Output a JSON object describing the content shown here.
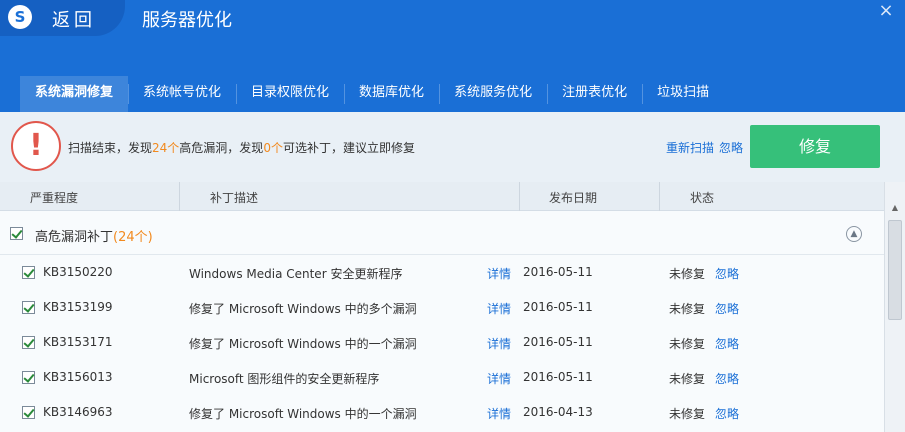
{
  "app": {
    "logo_letter": "S",
    "back_label": "返回",
    "title": "服务器优化",
    "close_glyph": "×"
  },
  "tabs": [
    {
      "label": "系统漏洞修复",
      "active": true
    },
    {
      "label": "系统帐号优化"
    },
    {
      "label": "目录权限优化"
    },
    {
      "label": "数据库优化"
    },
    {
      "label": "系统服务优化"
    },
    {
      "label": "注册表优化"
    },
    {
      "label": "垃圾扫描"
    }
  ],
  "scan_status": {
    "prefix": "扫描结束，发现",
    "high_risk_count": "24个",
    "middle": "高危漏洞，发现",
    "optional_count": "0个",
    "suffix": "可选补丁，建议立即修复",
    "rescan_label": "重新扫描",
    "ignore_label": "忽略",
    "repair_label": "修复",
    "alert_glyph": "!"
  },
  "columns": {
    "severity": "严重程度",
    "description": "补丁描述",
    "date": "发布日期",
    "status": "状态"
  },
  "group": {
    "label": "高危漏洞补丁",
    "count": "(24个)",
    "checked": true
  },
  "patches": [
    {
      "kb": "KB3150220",
      "desc": "Windows Media Center 安全更新程序",
      "detail": "详情",
      "date": "2016-05-11",
      "status": "未修复",
      "ignore": "忽略"
    },
    {
      "kb": "KB3153199",
      "desc": "修复了 Microsoft Windows 中的多个漏洞",
      "detail": "详情",
      "date": "2016-05-11",
      "status": "未修复",
      "ignore": "忽略"
    },
    {
      "kb": "KB3153171",
      "desc": "修复了 Microsoft Windows 中的一个漏洞",
      "detail": "详情",
      "date": "2016-05-11",
      "status": "未修复",
      "ignore": "忽略"
    },
    {
      "kb": "KB3156013",
      "desc": "Microsoft 图形组件的安全更新程序",
      "detail": "详情",
      "date": "2016-05-11",
      "status": "未修复",
      "ignore": "忽略"
    },
    {
      "kb": "KB3146963",
      "desc": "修复了 Microsoft Windows 中的一个漏洞",
      "detail": "详情",
      "date": "2016-04-13",
      "status": "未修复",
      "ignore": "忽略"
    }
  ],
  "colors": {
    "header_blue": "#1a6fd6",
    "accent_orange": "#f28a1f",
    "repair_green": "#36c07a",
    "alert_red": "#e1574c",
    "link_blue": "#1a6fd6"
  }
}
